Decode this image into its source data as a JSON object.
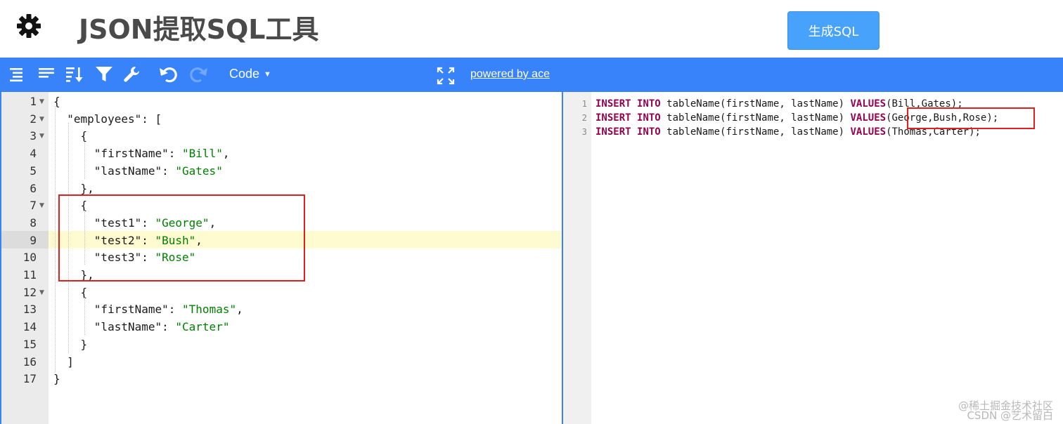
{
  "header": {
    "title": "JSON提取SQL工具",
    "generate_button": "生成SQL",
    "settings_icon": "gear-icon"
  },
  "toolbar": {
    "icons": [
      "format-icon",
      "compact-icon",
      "sort-icon",
      "filter-icon",
      "transform-icon",
      "undo-icon",
      "redo-icon",
      "fullscreen-icon"
    ],
    "mode_label": "Code",
    "powered_by": "powered by ace",
    "accent_color": "#3883fa"
  },
  "json_editor": {
    "line_numbers": [
      "1",
      "2",
      "3",
      "4",
      "5",
      "6",
      "7",
      "8",
      "9",
      "10",
      "11",
      "12",
      "13",
      "14",
      "15",
      "16",
      "17"
    ],
    "active_line": "9",
    "lines": [
      {
        "indent": "",
        "parts": [
          [
            "p",
            "{"
          ]
        ]
      },
      {
        "indent": "  ",
        "parts": [
          [
            "k",
            "\"employees\""
          ],
          [
            "p",
            ": ["
          ]
        ]
      },
      {
        "indent": "    ",
        "parts": [
          [
            "p",
            "{"
          ]
        ]
      },
      {
        "indent": "      ",
        "parts": [
          [
            "k",
            "\"firstName\""
          ],
          [
            "p",
            ": "
          ],
          [
            "s",
            "\"Bill\""
          ],
          [
            "p",
            ","
          ]
        ]
      },
      {
        "indent": "      ",
        "parts": [
          [
            "k",
            "\"lastName\""
          ],
          [
            "p",
            ": "
          ],
          [
            "s",
            "\"Gates\""
          ]
        ]
      },
      {
        "indent": "    ",
        "parts": [
          [
            "p",
            "},"
          ]
        ]
      },
      {
        "indent": "    ",
        "parts": [
          [
            "p",
            "{"
          ]
        ]
      },
      {
        "indent": "      ",
        "parts": [
          [
            "k",
            "\"test1\""
          ],
          [
            "p",
            ": "
          ],
          [
            "s",
            "\"George\""
          ],
          [
            "p",
            ","
          ]
        ]
      },
      {
        "indent": "      ",
        "parts": [
          [
            "k",
            "\"test2\""
          ],
          [
            "p",
            ": "
          ],
          [
            "s",
            "\"Bush\""
          ],
          [
            "p",
            ","
          ]
        ]
      },
      {
        "indent": "      ",
        "parts": [
          [
            "k",
            "\"test3\""
          ],
          [
            "p",
            ": "
          ],
          [
            "s",
            "\"Rose\""
          ]
        ]
      },
      {
        "indent": "    ",
        "parts": [
          [
            "p",
            "},"
          ]
        ]
      },
      {
        "indent": "    ",
        "parts": [
          [
            "p",
            "{"
          ]
        ]
      },
      {
        "indent": "      ",
        "parts": [
          [
            "k",
            "\"firstName\""
          ],
          [
            "p",
            ": "
          ],
          [
            "s",
            "\"Thomas\""
          ],
          [
            "p",
            ","
          ]
        ]
      },
      {
        "indent": "      ",
        "parts": [
          [
            "k",
            "\"lastName\""
          ],
          [
            "p",
            ": "
          ],
          [
            "s",
            "\"Carter\""
          ]
        ]
      },
      {
        "indent": "    ",
        "parts": [
          [
            "p",
            "}"
          ]
        ]
      },
      {
        "indent": "  ",
        "parts": [
          [
            "p",
            "]"
          ]
        ]
      },
      {
        "indent": "",
        "parts": [
          [
            "p",
            "}"
          ]
        ]
      }
    ],
    "foldable_lines": [
      "1",
      "2",
      "3",
      "7",
      "12"
    ]
  },
  "sql_output": {
    "line_numbers": [
      "1",
      "2",
      "3"
    ],
    "lines": [
      {
        "kw1": "INSERT",
        "kw2": "INTO",
        "table": " tableName",
        "cols": "(firstName, lastName)",
        "kw3": "VALUES",
        "vals": "(Bill,Gates);"
      },
      {
        "kw1": "INSERT",
        "kw2": "INTO",
        "table": " tableName",
        "cols": "(firstName, lastName)",
        "kw3": "VALUES",
        "vals": "(George,Bush,Rose);"
      },
      {
        "kw1": "INSERT",
        "kw2": "INTO",
        "table": " tableName",
        "cols": "(firstName, lastName)",
        "kw3": "VALUES",
        "vals": "(Thomas,Carter);"
      }
    ]
  },
  "watermark": {
    "line1": "@稀土掘金技术社区",
    "line2": "CSDN @艺术留白"
  }
}
